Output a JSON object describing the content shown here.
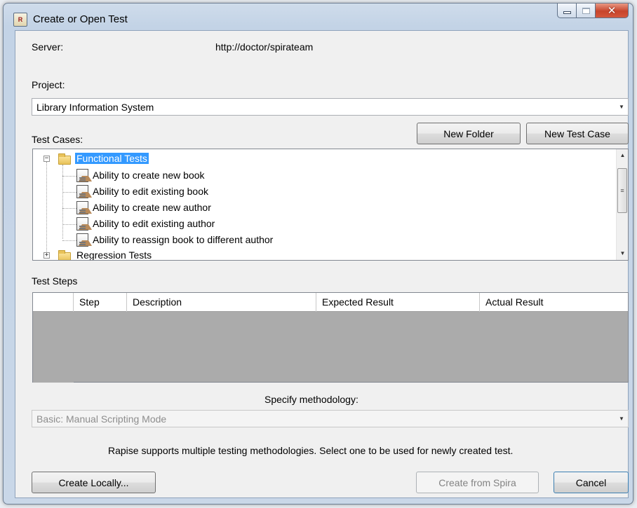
{
  "window": {
    "title": "Create or Open Test",
    "app_icon_text": "R"
  },
  "server": {
    "label": "Server:",
    "value": "http://doctor/spirateam"
  },
  "project": {
    "label": "Project:",
    "selected": "Library Information System"
  },
  "test_cases": {
    "label": "Test Cases:",
    "new_folder_label": "New Folder",
    "new_test_case_label": "New Test Case",
    "tree": {
      "folders": [
        {
          "name": "Functional Tests",
          "expanded": true,
          "selected": true,
          "children": [
            "Ability to create new book",
            "Ability to edit existing book",
            "Ability to create new author",
            "Ability to edit existing author",
            "Ability to reassign book to different author"
          ]
        },
        {
          "name": "Regression Tests",
          "expanded": false,
          "selected": false
        }
      ]
    }
  },
  "test_steps": {
    "label": "Test Steps",
    "columns": [
      "Step",
      "Description",
      "Expected Result",
      "Actual Result"
    ],
    "rows": []
  },
  "methodology": {
    "label": "Specify methodology:",
    "selected": "Basic: Manual Scripting Mode",
    "enabled": false,
    "hint": "Rapise supports multiple testing methodologies. Select one to be used for newly created test."
  },
  "buttons": {
    "create_locally": "Create Locally...",
    "create_from_spira": "Create from Spira",
    "cancel": "Cancel"
  },
  "icons": {
    "caption_close": "close-icon",
    "caption_min": "minimize-icon",
    "caption_max": "maximize-icon",
    "dropdown": "chevron-down-icon",
    "folder": "folder-icon",
    "test_case": "test-case-icon"
  },
  "colors": {
    "selection": "#3399ff",
    "close_button": "#c7452c",
    "grid_background": "#ababab"
  }
}
